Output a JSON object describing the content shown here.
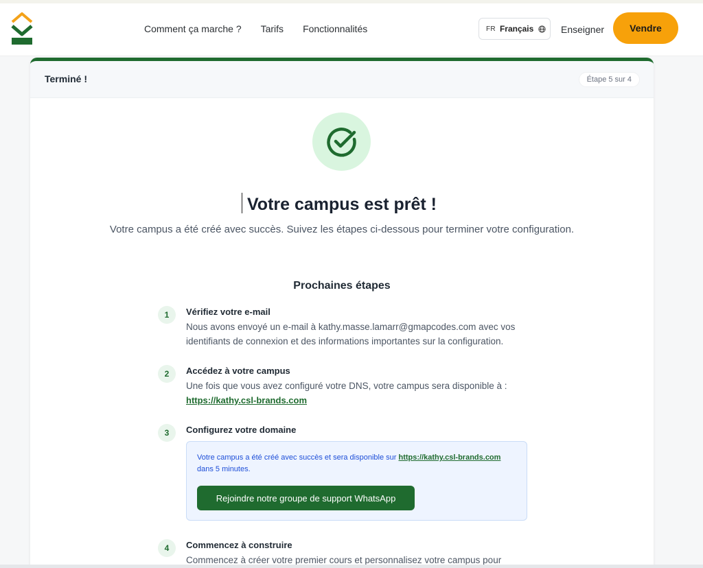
{
  "header": {
    "nav": [
      "Comment ça marche ?",
      "Tarifs",
      "Fonctionnalités"
    ],
    "lang_code": "FR",
    "lang_name": "Français",
    "teach_label": "Enseigner",
    "sell_label": "Vendre"
  },
  "card": {
    "title": "Terminé !",
    "step_indicator": "Étape 5 sur 4",
    "headline": "Votre campus est prêt !",
    "subline": "Votre campus a été créé avec succès. Suivez les étapes ci-dessous pour terminer votre configuration.",
    "next_title": "Prochaines étapes",
    "steps": [
      {
        "num": "1",
        "title": "Vérifiez votre e-mail",
        "text": "Nous avons envoyé un e-mail à kathy.masse.lamarr@gmapcodes.com avec vos identifiants de connexion et des informations importantes sur la configuration."
      },
      {
        "num": "2",
        "title": "Accédez à votre campus",
        "text": "Une fois que vous avez configuré votre DNS, votre campus sera disponible à :",
        "link": "https://kathy.csl-brands.com"
      },
      {
        "num": "3",
        "title": "Configurez votre domaine",
        "info_prefix": "Votre campus a été créé avec succès et sera disponible sur",
        "info_link": "https://kathy.csl-brands.com",
        "info_suffix": "dans 5 minutes.",
        "button": "Rejoindre notre groupe de support WhatsApp"
      },
      {
        "num": "4",
        "title": "Commencez à construire",
        "text": "Commencez à créer votre premier cours et personnalisez votre campus pour"
      }
    ]
  },
  "colors": {
    "brand_green": "#1f6b2f",
    "accent_orange": "#f7a10a",
    "success_bg": "#d9f5df",
    "info_bg": "#eef4ff",
    "info_text": "#1d4ed8"
  },
  "icons": {
    "logo": "k-logo-icon",
    "language": "globe-icon",
    "success": "check-circle-icon"
  }
}
